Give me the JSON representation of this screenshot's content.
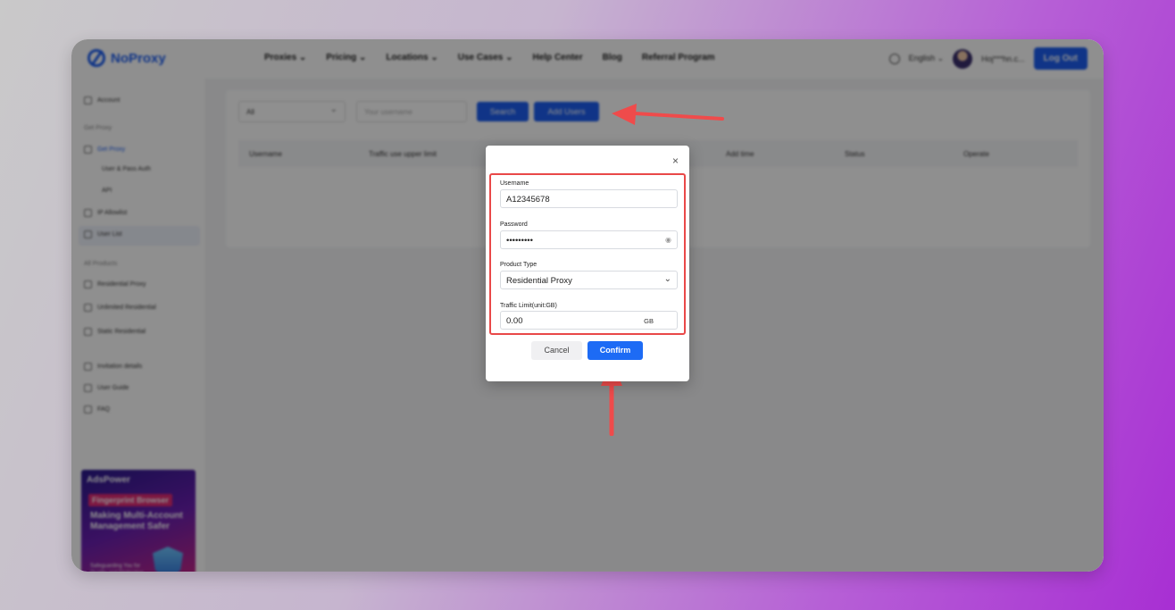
{
  "topnav": {
    "brand": "NoProxy",
    "links": [
      "Proxies ⌄",
      "Pricing ⌄",
      "Locations ⌄",
      "Use Cases ⌄",
      "Help Center",
      "Blog",
      "Referral Program"
    ],
    "language": "English ⌄",
    "user": "Hoj***hn.c...",
    "logout": "Log Out"
  },
  "sidebar": {
    "account": "Account",
    "get_proxy_group": "Get Proxy",
    "get_proxy": "Get Proxy",
    "user_pass_auth": "User & Pass Auth",
    "api": "API",
    "ip_allowlist": "IP Allowlist",
    "user_list": "User List",
    "all_products_group": "All Products",
    "residential_proxy": "Residential Proxy",
    "unlimited_residential": "Unlimited Residential",
    "static_residential": "Static Residential",
    "invitation_details": "Invitation details",
    "user_guide": "User Guide",
    "faq": "FAQ",
    "ad": {
      "brand": "AdsPower",
      "tag": "Fingerprint Browser",
      "headline": "Making Multi-Account Management Safer",
      "sub": "Safeguarding You for Quality and Distinction"
    }
  },
  "toolbar": {
    "filter_value": "All",
    "username_placeholder": "Your username",
    "search": "Search",
    "add_users": "Add Users"
  },
  "table": {
    "columns": [
      "Username",
      "Traffic use upper limit",
      "Add time",
      "Status",
      "Operate"
    ]
  },
  "modal": {
    "close": "×",
    "username_label": "Username",
    "username_value": "A12345678",
    "password_label": "Password",
    "password_value": "•••••••••",
    "product_type_label": "Product Type",
    "product_type_value": "Residential Proxy",
    "traffic_limit_label": "Traffic Limit(unit:GB)",
    "traffic_limit_value": "0.00",
    "traffic_unit": "GB",
    "cancel": "Cancel",
    "confirm": "Confirm"
  },
  "colors": {
    "accent": "#1d5ef0",
    "highlight": "#e94848"
  }
}
